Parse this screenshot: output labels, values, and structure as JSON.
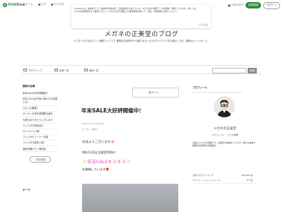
{
  "header": {
    "logo_text": "Ameba",
    "nav": [
      "ホーム",
      "ピグ",
      "アメブロ"
    ],
    "user_link": "人気ブログ",
    "signup": "新規登録",
    "login": "ログイン"
  },
  "cookie": {
    "text": "Amebaでは、快適なサービス提供や利用分析、広告配信のためにクッキーなどを使い利用データの取得・利用しています。詳しくは Ameba利用規約 をご確認ください。また引き続き閲覧しお客様情報を関して、当社、利用規約に同意ください。",
    "close": "とじる"
  },
  "blog": {
    "title": "メガネの正美堂のブログ",
    "description": "小さなメガネ店のネット通販ストアです 福岡県太宰府市から魅力あるメガネやサングラスをお届けします。趣味はハンドボール。"
  },
  "tabs": {
    "top": "ブログトップ",
    "articles": "記事一覧",
    "images": "画像一覧",
    "search_button": "検索"
  },
  "left": {
    "recent_title": "最新の記事",
    "recent_items": [
      "年末SALE大好評開催中！",
      "本日12/10は午後１時からの営業です！",
      "いよいよ開幕！",
      "サッカー日本代表惜敗お疲れ",
      "今週もありがとうございます",
      "フェラガモ新作紹介",
      "ロンジャン入荷！",
      "フェラガモフーナー完成",
      "フェラガモ新作入荷！",
      "宮崎月曜から一周年記"
    ],
    "list_button": "一覧を見る",
    "theme_title": "テーマ"
  },
  "article": {
    "next_label": "次ページ",
    "title": "年末SALE大好評開催中！",
    "date": "2022-12-09 16:09:11",
    "theme_label": "テーマ：",
    "theme_link": "ブログ",
    "greeting": "おはようございます🌸",
    "sale_line": "毎年12月は正美堂恒例の",
    "sale_kira": "年末SALEキラキラ",
    "sale_do": "を開催しています🎁"
  },
  "profile": {
    "title": "プロフィール",
    "name": "メガネの正美堂",
    "sub": "プロフィール ・ ピグの部屋",
    "description": "当店はメガネの老舗です。お客様の信頼をいただき、確かな技術で...福岡県太宰府市の眼鏡店 ...",
    "ranking": [
      {
        "label": "全体ブログランキング ",
        "value": "150,012 位"
      },
      {
        "label": "アパレル・ショップ ジャンル",
        "value": "67 位"
      }
    ]
  }
}
